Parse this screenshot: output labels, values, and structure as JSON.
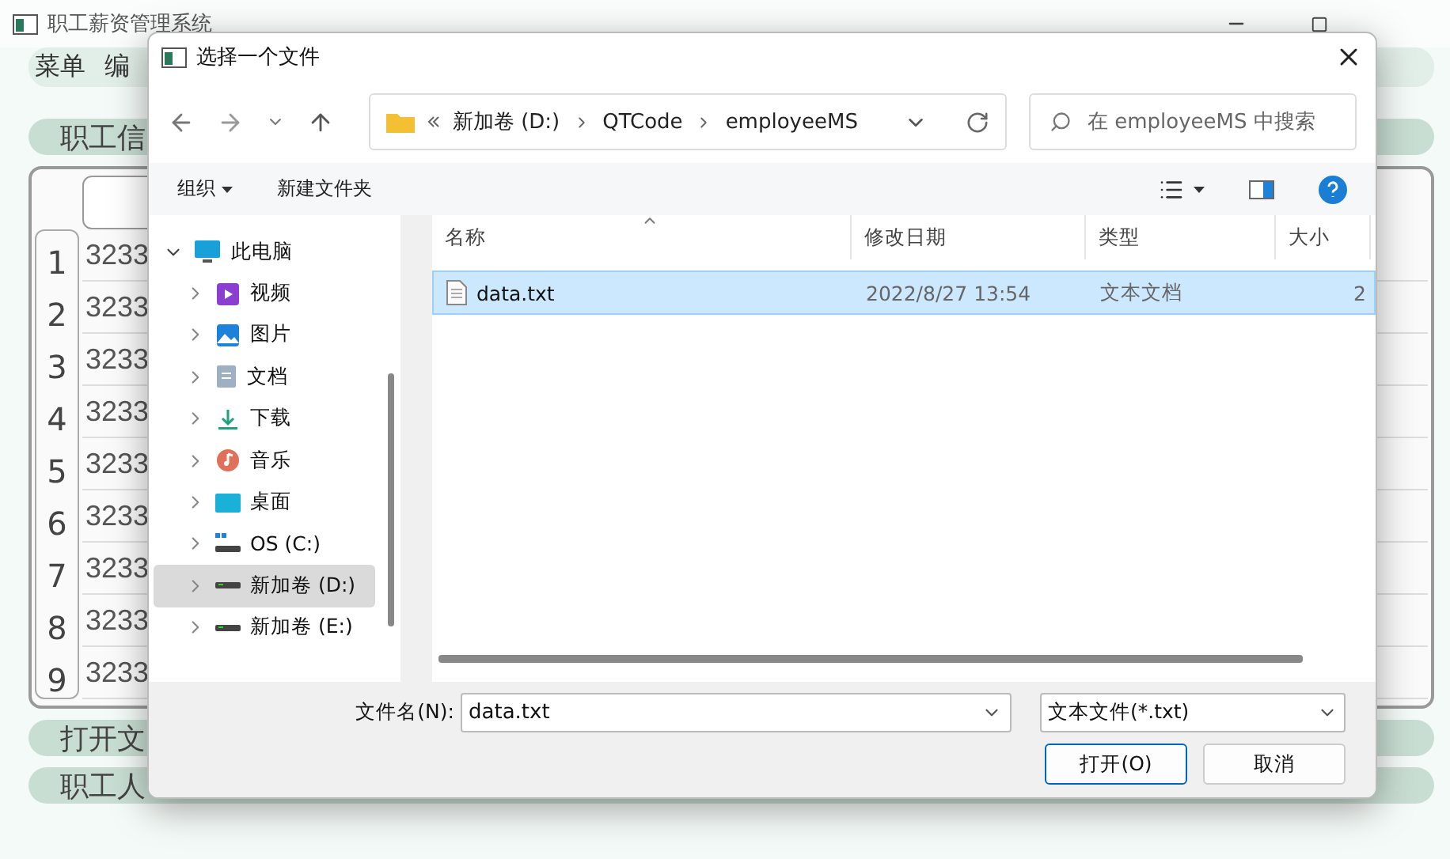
{
  "app": {
    "title": "职工薪资管理系统",
    "menu": [
      "菜单",
      "编"
    ],
    "section_title": "职工信",
    "rows": [
      {
        "number": "1",
        "cell": "3233"
      },
      {
        "number": "2",
        "cell": "3233"
      },
      {
        "number": "3",
        "cell": "3233"
      },
      {
        "number": "4",
        "cell": "3233"
      },
      {
        "number": "5",
        "cell": "3233"
      },
      {
        "number": "6",
        "cell": "3233"
      },
      {
        "number": "7",
        "cell": "3233"
      },
      {
        "number": "8",
        "cell": "3233"
      },
      {
        "number": "9",
        "cell": "3233"
      }
    ],
    "footer": [
      "打开文",
      "职工人"
    ]
  },
  "dialog": {
    "title": "选择一个文件",
    "address": [
      "新加卷 (D:)",
      "QTCode",
      "employeeMS"
    ],
    "search": {
      "placeholder": "在 employeeMS 中搜索"
    },
    "toolbar": {
      "organize": "组织",
      "new_folder": "新建文件夹"
    },
    "tree": [
      {
        "label": "此电脑",
        "kind": "pc",
        "expanded": true,
        "selected": false,
        "children": [
          {
            "label": "视频",
            "kind": "video",
            "expanded": false,
            "selected": false
          },
          {
            "label": "图片",
            "kind": "pictures",
            "expanded": false,
            "selected": false
          },
          {
            "label": "文档",
            "kind": "documents",
            "expanded": false,
            "selected": false
          },
          {
            "label": "下载",
            "kind": "downloads",
            "expanded": false,
            "selected": false
          },
          {
            "label": "音乐",
            "kind": "music",
            "expanded": false,
            "selected": false
          },
          {
            "label": "桌面",
            "kind": "desktop",
            "expanded": false,
            "selected": false
          },
          {
            "label": "OS (C:)",
            "kind": "system-drive",
            "expanded": false,
            "selected": false
          },
          {
            "label": "新加卷 (D:)",
            "kind": "drive",
            "expanded": false,
            "selected": true
          },
          {
            "label": "新加卷 (E:)",
            "kind": "drive",
            "expanded": false,
            "selected": false
          }
        ]
      }
    ],
    "columns": [
      "名称",
      "修改日期",
      "类型",
      "大小"
    ],
    "files": [
      {
        "name": "data.txt",
        "modified": "2022/8/27 13:54",
        "type": "文本文档",
        "size": "2",
        "selected": true
      }
    ],
    "filename": {
      "label": "文件名(N):",
      "value": "data.txt"
    },
    "filter": "文本文件(*.txt)",
    "buttons": [
      {
        "label": "打开(O)",
        "kind": "primary"
      },
      {
        "label": "取消",
        "kind": "secondary"
      }
    ]
  }
}
